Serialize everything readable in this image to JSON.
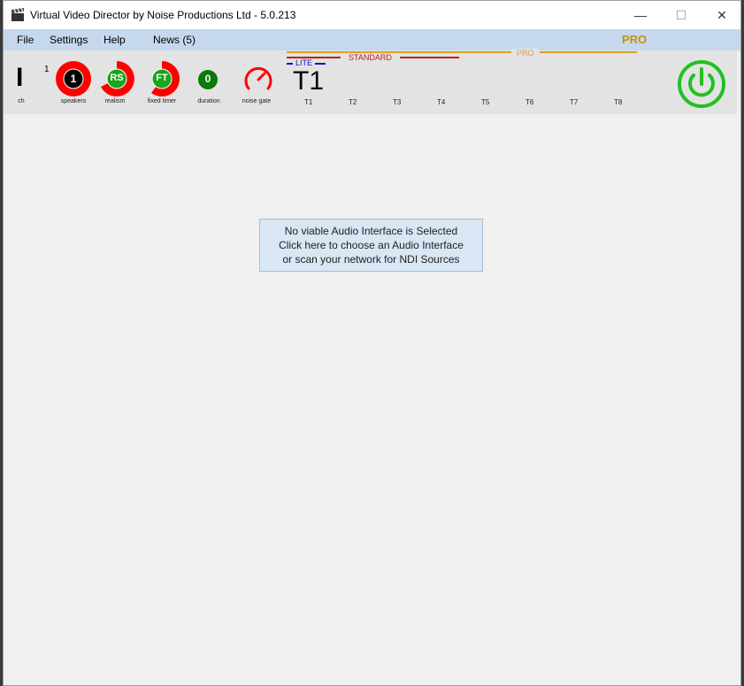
{
  "window": {
    "title": "Virtual Video Director by Noise Productions Ltd - 5.0.213",
    "minimize_glyph": "—",
    "maximize_glyph": "☐",
    "close_glyph": "✕"
  },
  "menu": {
    "items": [
      "File",
      "Settings",
      "Help",
      "News (5)"
    ],
    "pro_badge": "PRO"
  },
  "toolbar": {
    "channel_glyph": "I",
    "channel_label": "ch",
    "channel_count": "1",
    "speakers": {
      "value": "1",
      "label": "speakers"
    },
    "realism": {
      "value": "RS",
      "label": "realism"
    },
    "fixed_timer": {
      "value": "FT",
      "label": "fixed timer"
    },
    "duration": {
      "value": "0",
      "label": "duration"
    },
    "noise_gate": {
      "label": "noise gate"
    },
    "tiers": {
      "lite": "LITE",
      "standard": "STANDARD",
      "pro": "PRO"
    },
    "current_take": "T1",
    "takes": [
      "T1",
      "T2",
      "T3",
      "T4",
      "T5",
      "T6",
      "T7",
      "T8"
    ]
  },
  "notice": {
    "line1": "No viable Audio Interface is Selected",
    "line2": "Click here to choose an Audio Interface",
    "line3": "or scan your network for NDI Sources"
  },
  "colors": {
    "red": "#ff0000",
    "green": "#1aa51a",
    "dark_green": "#0a7a0a",
    "power_green": "#22c022",
    "pro_gold": "#c89010",
    "lite_blue": "#1010d0",
    "standard_red": "#c02020"
  },
  "icons": {
    "app": "clapperboard-icon",
    "power": "power-icon",
    "noise_gate": "dial-icon"
  }
}
